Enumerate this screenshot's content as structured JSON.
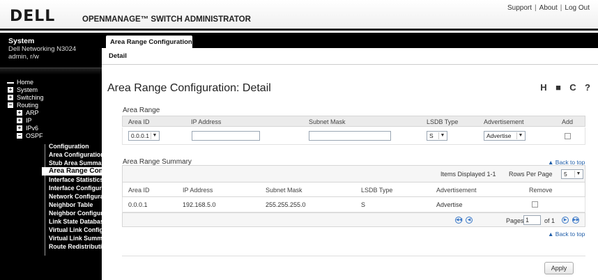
{
  "header": {
    "logo": "DELL",
    "app_title": "OPENMANAGE™ SWITCH ADMINISTRATOR",
    "links": [
      "Support",
      "About",
      "Log Out"
    ]
  },
  "sidebar": {
    "system_title": "System",
    "device": "Dell Networking N3024",
    "user": "admin, r/w",
    "nav": [
      {
        "label": "Home"
      },
      {
        "label": "System"
      },
      {
        "label": "Switching"
      },
      {
        "label": "Routing"
      },
      {
        "label": "ARP"
      },
      {
        "label": "IP"
      },
      {
        "label": "IPv6"
      },
      {
        "label": "OSPF"
      }
    ],
    "ospf_items": [
      "Configuration",
      "Area Configuration",
      "Stub Area Summary",
      "Area Range Conf",
      "Interface Statistics",
      "Interface Configurat",
      "Network Configurati",
      "Neighbor Table",
      "Neighbor Configura",
      "Link State Databas",
      "Virtual Link Configu",
      "Virtual Link Summa",
      "Route Redistributio"
    ]
  },
  "tabs": {
    "active": "Area Range Configuration",
    "sub": "Detail"
  },
  "main": {
    "title": "Area Range Configuration: Detail",
    "tools": {
      "help_glyph": "H",
      "print_glyph": "■",
      "refresh_glyph": "C",
      "question_glyph": "?"
    },
    "area_range": {
      "label": "Area Range",
      "headers": [
        "Area ID",
        "IP Address",
        "Subnet Mask",
        "LSDB Type",
        "Advertisement",
        "Add"
      ],
      "area_id_value": "0.0.0.1",
      "lsdb_value": "S",
      "advert_value": "Advertise"
    },
    "summary": {
      "label": "Area Range Summary",
      "back_to_top": "Back to top",
      "items_displayed": "Items Displayed 1-1",
      "rows_per_page_label": "Rows Per Page",
      "rows_per_page_value": "5",
      "headers": [
        "Area ID",
        "IP Address",
        "Subnet Mask",
        "LSDB Type",
        "Advertisement",
        "Remove"
      ],
      "row": {
        "area_id": "0.0.0.1",
        "ip": "192.168.5.0",
        "mask": "255.255.255.0",
        "lsdb": "S",
        "advert": "Advertise"
      },
      "pages_label": "Pages",
      "page_value": "1",
      "of_label": "of 1",
      "back_to_top2": "Back to top"
    },
    "apply_label": "Apply"
  },
  "colors": {
    "link": "#1f5da8",
    "sidebar_bg": "#000000"
  }
}
